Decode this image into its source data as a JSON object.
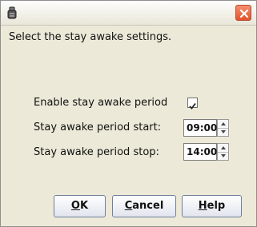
{
  "dialog": {
    "title": "",
    "instruction": "Select the stay awake settings."
  },
  "settings": {
    "enable_label": "Enable stay awake period",
    "enable_checked": true,
    "start_label": "Stay awake period start:",
    "start_value": "09:00",
    "stop_label": "Stay awake period stop:",
    "stop_value": "14:00"
  },
  "buttons": {
    "ok": {
      "mnemonic": "O",
      "rest": "K"
    },
    "cancel": {
      "mnemonic": "C",
      "rest": "ancel"
    },
    "help": {
      "mnemonic": "H",
      "rest": "elp"
    }
  },
  "icons": {
    "app": "java-cup-icon",
    "close": "close-icon",
    "checkbox": "checkmark-icon",
    "spinner_up": "spinner-up-arrow-icon",
    "spinner_down": "spinner-down-arrow-icon"
  },
  "colors": {
    "close_button": "#e2532c",
    "dialog_background": "#ece9d8"
  }
}
